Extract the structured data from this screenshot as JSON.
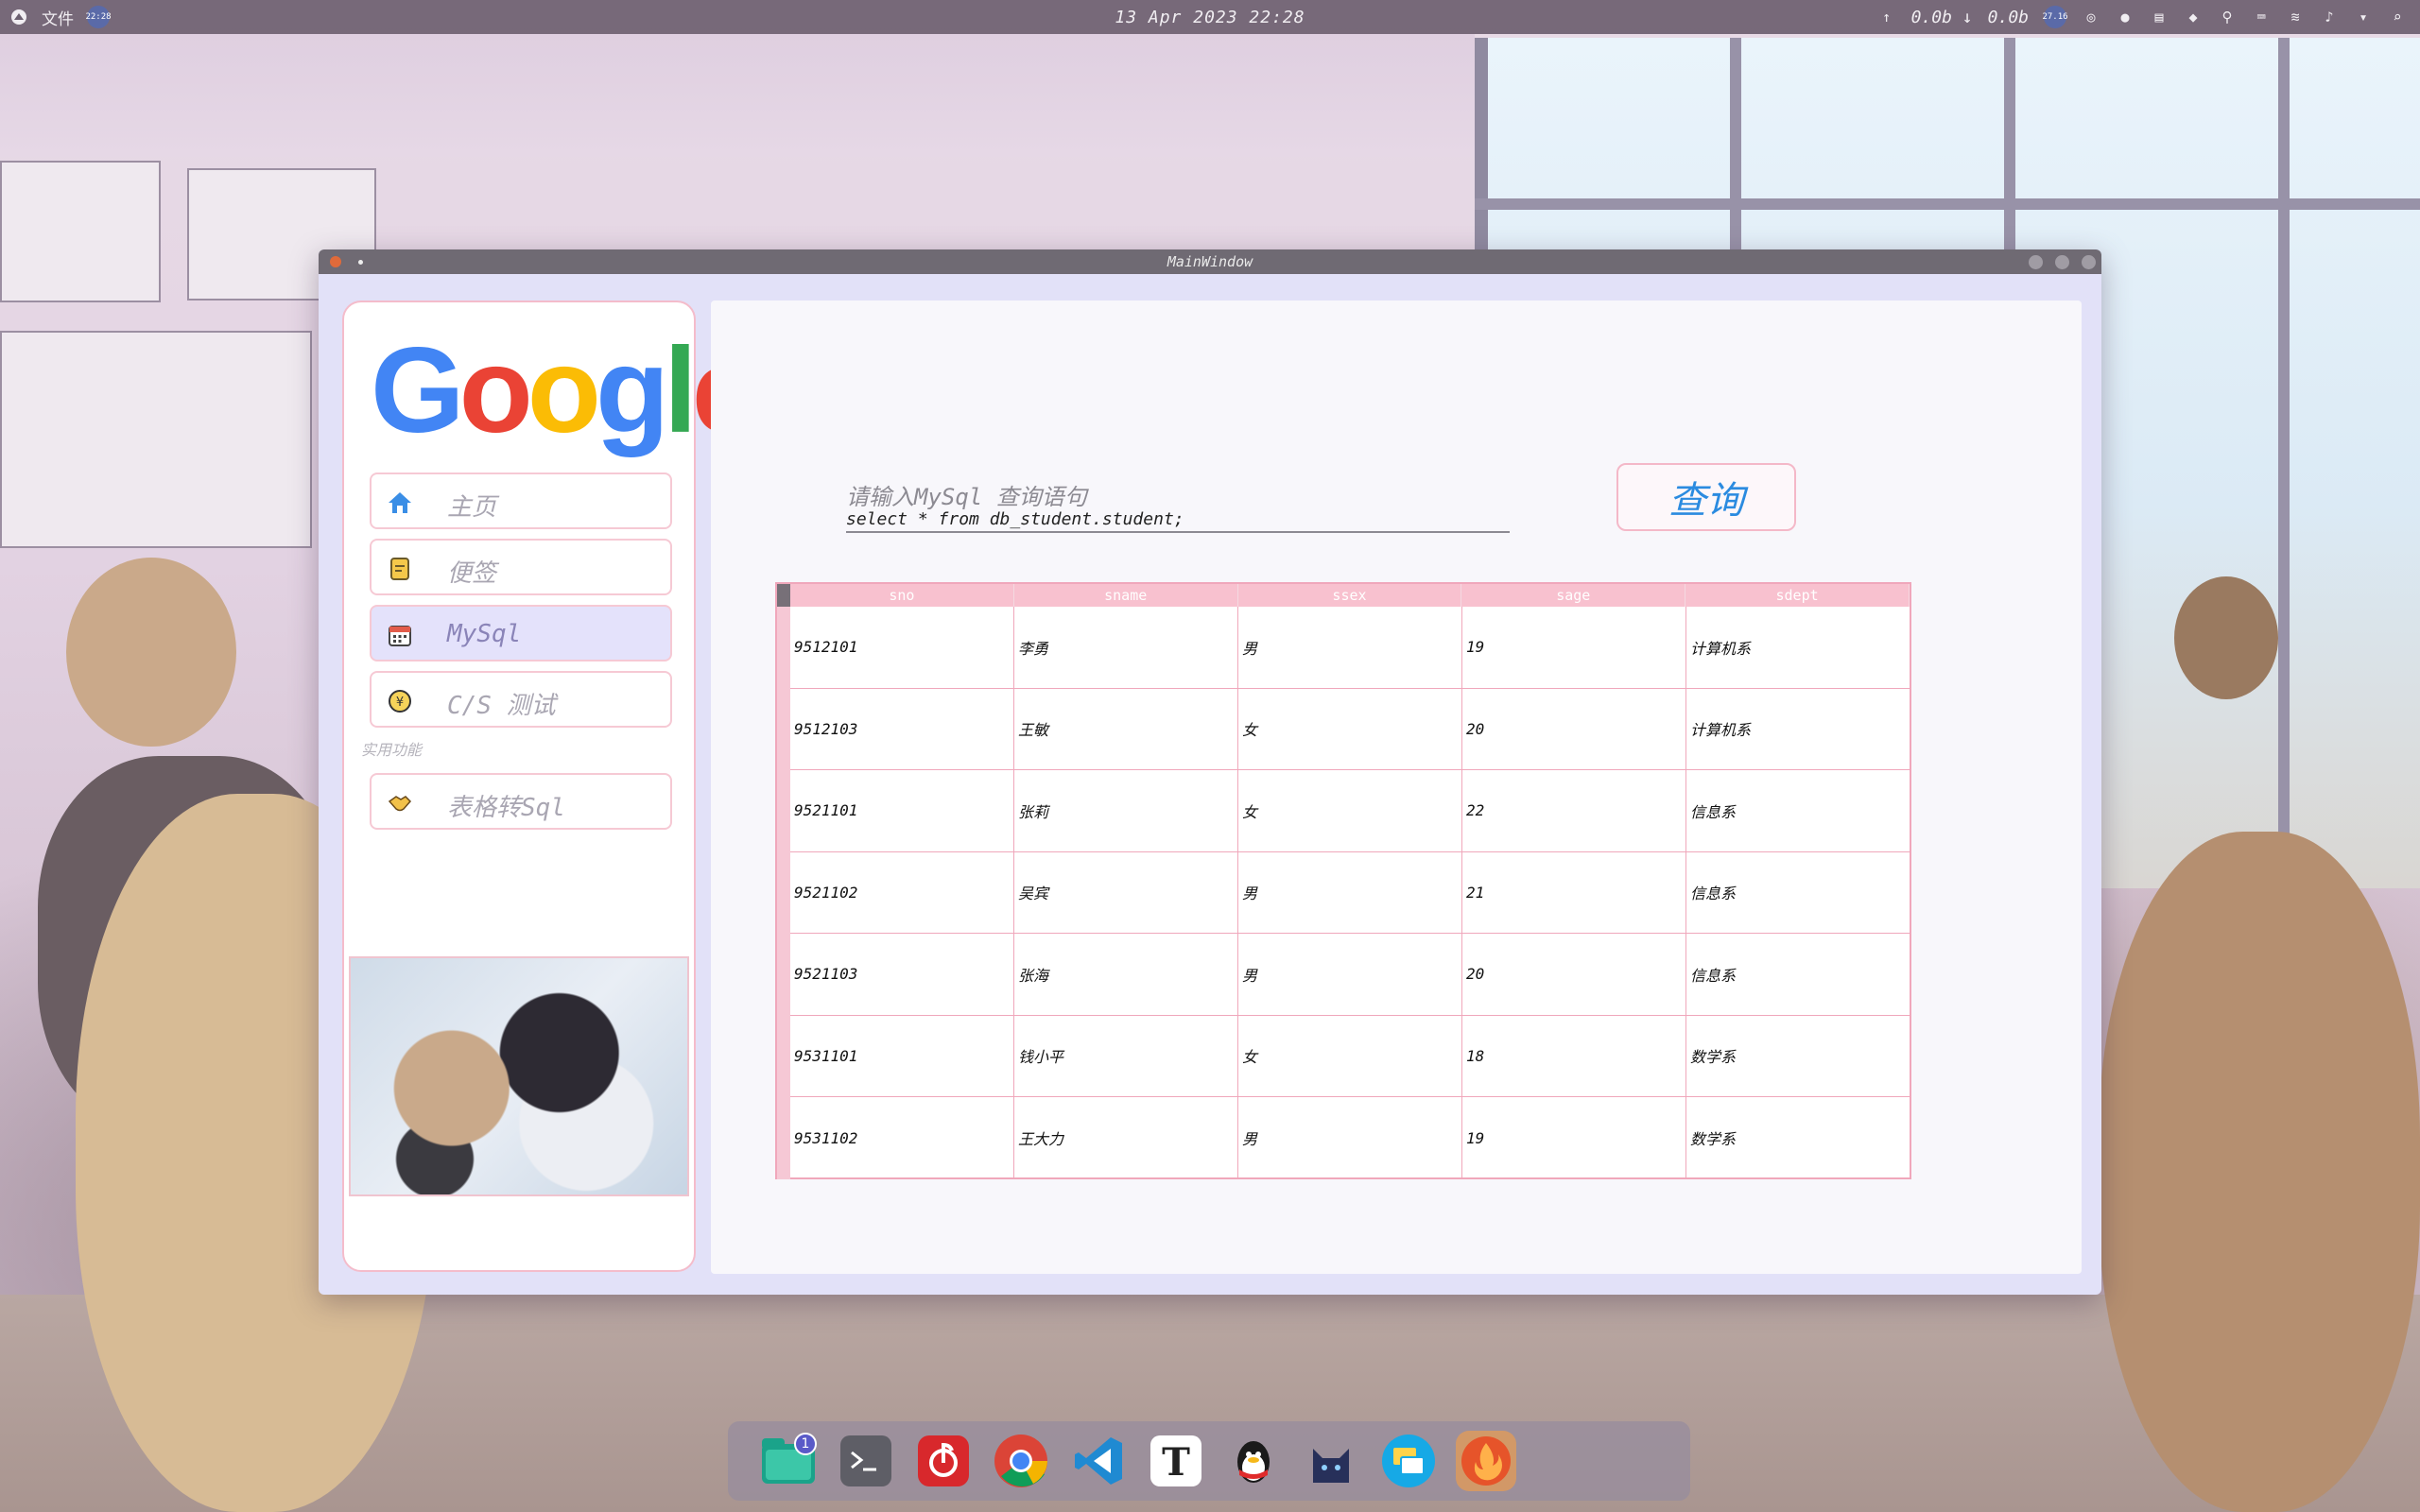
{
  "topbar": {
    "menu_label": "文件",
    "clock_small": "22:28",
    "datetime": "13 Apr 2023 22:28",
    "net_up": "0.0b",
    "net_down": "0.0b",
    "badge_text": "27.16"
  },
  "window": {
    "title": "MainWindow"
  },
  "sidebar": {
    "logo_letters": [
      "G",
      "o",
      "o",
      "g",
      "l",
      "e"
    ],
    "items": [
      {
        "label": "主页",
        "icon": "home-icon"
      },
      {
        "label": "便签",
        "icon": "note-icon"
      },
      {
        "label": "MySql",
        "icon": "calendar-icon"
      },
      {
        "label": "C/S 测试",
        "icon": "yen-cycle-icon"
      }
    ],
    "section_label": "实用功能",
    "tools": [
      {
        "label": "表格转Sql",
        "icon": "handshake-icon"
      }
    ]
  },
  "query": {
    "placeholder": "请输入MySql 查询语句",
    "value": "select * from db_student.student;",
    "button_label": "查询"
  },
  "table": {
    "columns": [
      "sno",
      "sname",
      "ssex",
      "sage",
      "sdept"
    ],
    "rows": [
      [
        "9512101",
        "李勇",
        "男",
        "19",
        "计算机系"
      ],
      [
        "9512103",
        "王敏",
        "女",
        "20",
        "计算机系"
      ],
      [
        "9521101",
        "张莉",
        "女",
        "22",
        "信息系"
      ],
      [
        "9521102",
        "吴宾",
        "男",
        "21",
        "信息系"
      ],
      [
        "9521103",
        "张海",
        "男",
        "20",
        "信息系"
      ],
      [
        "9531101",
        "钱小平",
        "女",
        "18",
        "数学系"
      ],
      [
        "9531102",
        "王大力",
        "男",
        "19",
        "数学系"
      ]
    ]
  },
  "dock": {
    "badge_count": "1",
    "apps": [
      "file-manager",
      "terminal",
      "netease-music",
      "chrome",
      "vscode",
      "typora",
      "qq",
      "cat-app",
      "remote-desktop",
      "flame-app"
    ]
  },
  "colors": {
    "accent_pink": "#f0a7bb",
    "active_nav": "#e4e2fb",
    "query_button_text": "#2b8be0"
  }
}
